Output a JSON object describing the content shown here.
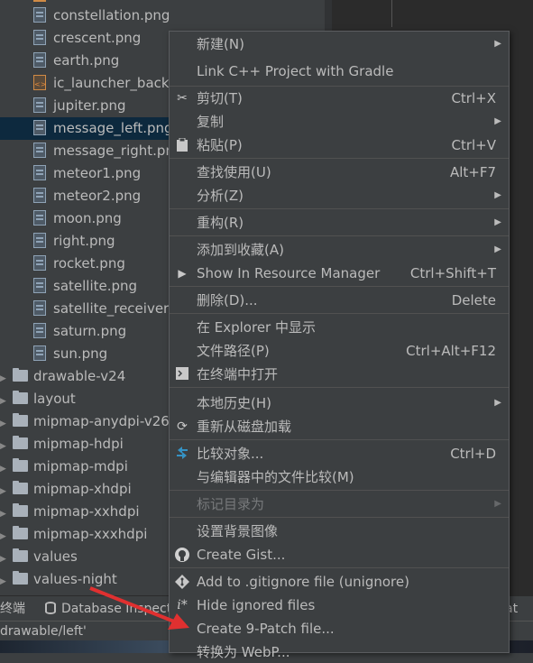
{
  "tree": {
    "files": [
      {
        "name": "constellation.png",
        "type": "png"
      },
      {
        "name": "crescent.png",
        "type": "png"
      },
      {
        "name": "earth.png",
        "type": "png"
      },
      {
        "name": "ic_launcher_backg",
        "type": "xml"
      },
      {
        "name": "jupiter.png",
        "type": "png"
      },
      {
        "name": "message_left.png",
        "type": "png"
      },
      {
        "name": "message_right.pn",
        "type": "png"
      },
      {
        "name": "meteor1.png",
        "type": "png"
      },
      {
        "name": "meteor2.png",
        "type": "png"
      },
      {
        "name": "moon.png",
        "type": "png"
      },
      {
        "name": "right.png",
        "type": "png"
      },
      {
        "name": "rocket.png",
        "type": "png"
      },
      {
        "name": "satellite.png",
        "type": "png"
      },
      {
        "name": "satellite_receiver.",
        "type": "png"
      },
      {
        "name": "saturn.png",
        "type": "png"
      },
      {
        "name": "sun.png",
        "type": "png"
      }
    ],
    "folders": [
      "drawable-v24",
      "layout",
      "mipmap-anydpi-v26",
      "mipmap-hdpi",
      "mipmap-mdpi",
      "mipmap-xhdpi",
      "mipmap-xxhdpi",
      "mipmap-xxxhdpi",
      "values",
      "values-night"
    ]
  },
  "toolbar": {
    "terminal": "终端",
    "database": "Database Inspect",
    "right": "at"
  },
  "statusbar": {
    "path": "drawable/left'"
  },
  "menu": {
    "new": {
      "label": "新建(N)"
    },
    "link_cpp": {
      "label": "Link C++ Project with Gradle"
    },
    "cut": {
      "label": "剪切(T)",
      "shortcut": "Ctrl+X"
    },
    "copy": {
      "label": "复制"
    },
    "paste": {
      "label": "粘贴(P)",
      "shortcut": "Ctrl+V"
    },
    "find_usages": {
      "label": "查找使用(U)",
      "shortcut": "Alt+F7"
    },
    "analyze": {
      "label": "分析(Z)"
    },
    "refactor": {
      "label": "重构(R)"
    },
    "add_favorites": {
      "label": "添加到收藏(A)"
    },
    "resource_manager": {
      "label": "Show In Resource Manager",
      "shortcut": "Ctrl+Shift+T"
    },
    "delete": {
      "label": "删除(D)...",
      "shortcut": "Delete"
    },
    "show_explorer": {
      "label": "在 Explorer 中显示"
    },
    "file_path": {
      "label": "文件路径(P)",
      "shortcut": "Ctrl+Alt+F12"
    },
    "open_terminal": {
      "label": "在终端中打开"
    },
    "local_history": {
      "label": "本地历史(H)"
    },
    "reload": {
      "label": "重新从磁盘加载"
    },
    "compare_with": {
      "label": "比较对象...",
      "shortcut": "Ctrl+D"
    },
    "compare_editor": {
      "label": "与编辑器中的文件比较(M)"
    },
    "mark_dir": {
      "label": "标记目录为"
    },
    "set_bg": {
      "label": "设置背景图像"
    },
    "create_gist": {
      "label": "Create Gist..."
    },
    "add_gitignore": {
      "label": "Add to .gitignore file (unignore)"
    },
    "hide_ignored": {
      "label": "Hide ignored files"
    },
    "create_9patch": {
      "label": "Create 9-Patch file..."
    },
    "convert_webp": {
      "label": "转换为 WebP..."
    }
  },
  "colors": {
    "menu_bg": "#3c3f41",
    "selected_row": "#0d293e",
    "annotation_arrow": "#e03030"
  }
}
